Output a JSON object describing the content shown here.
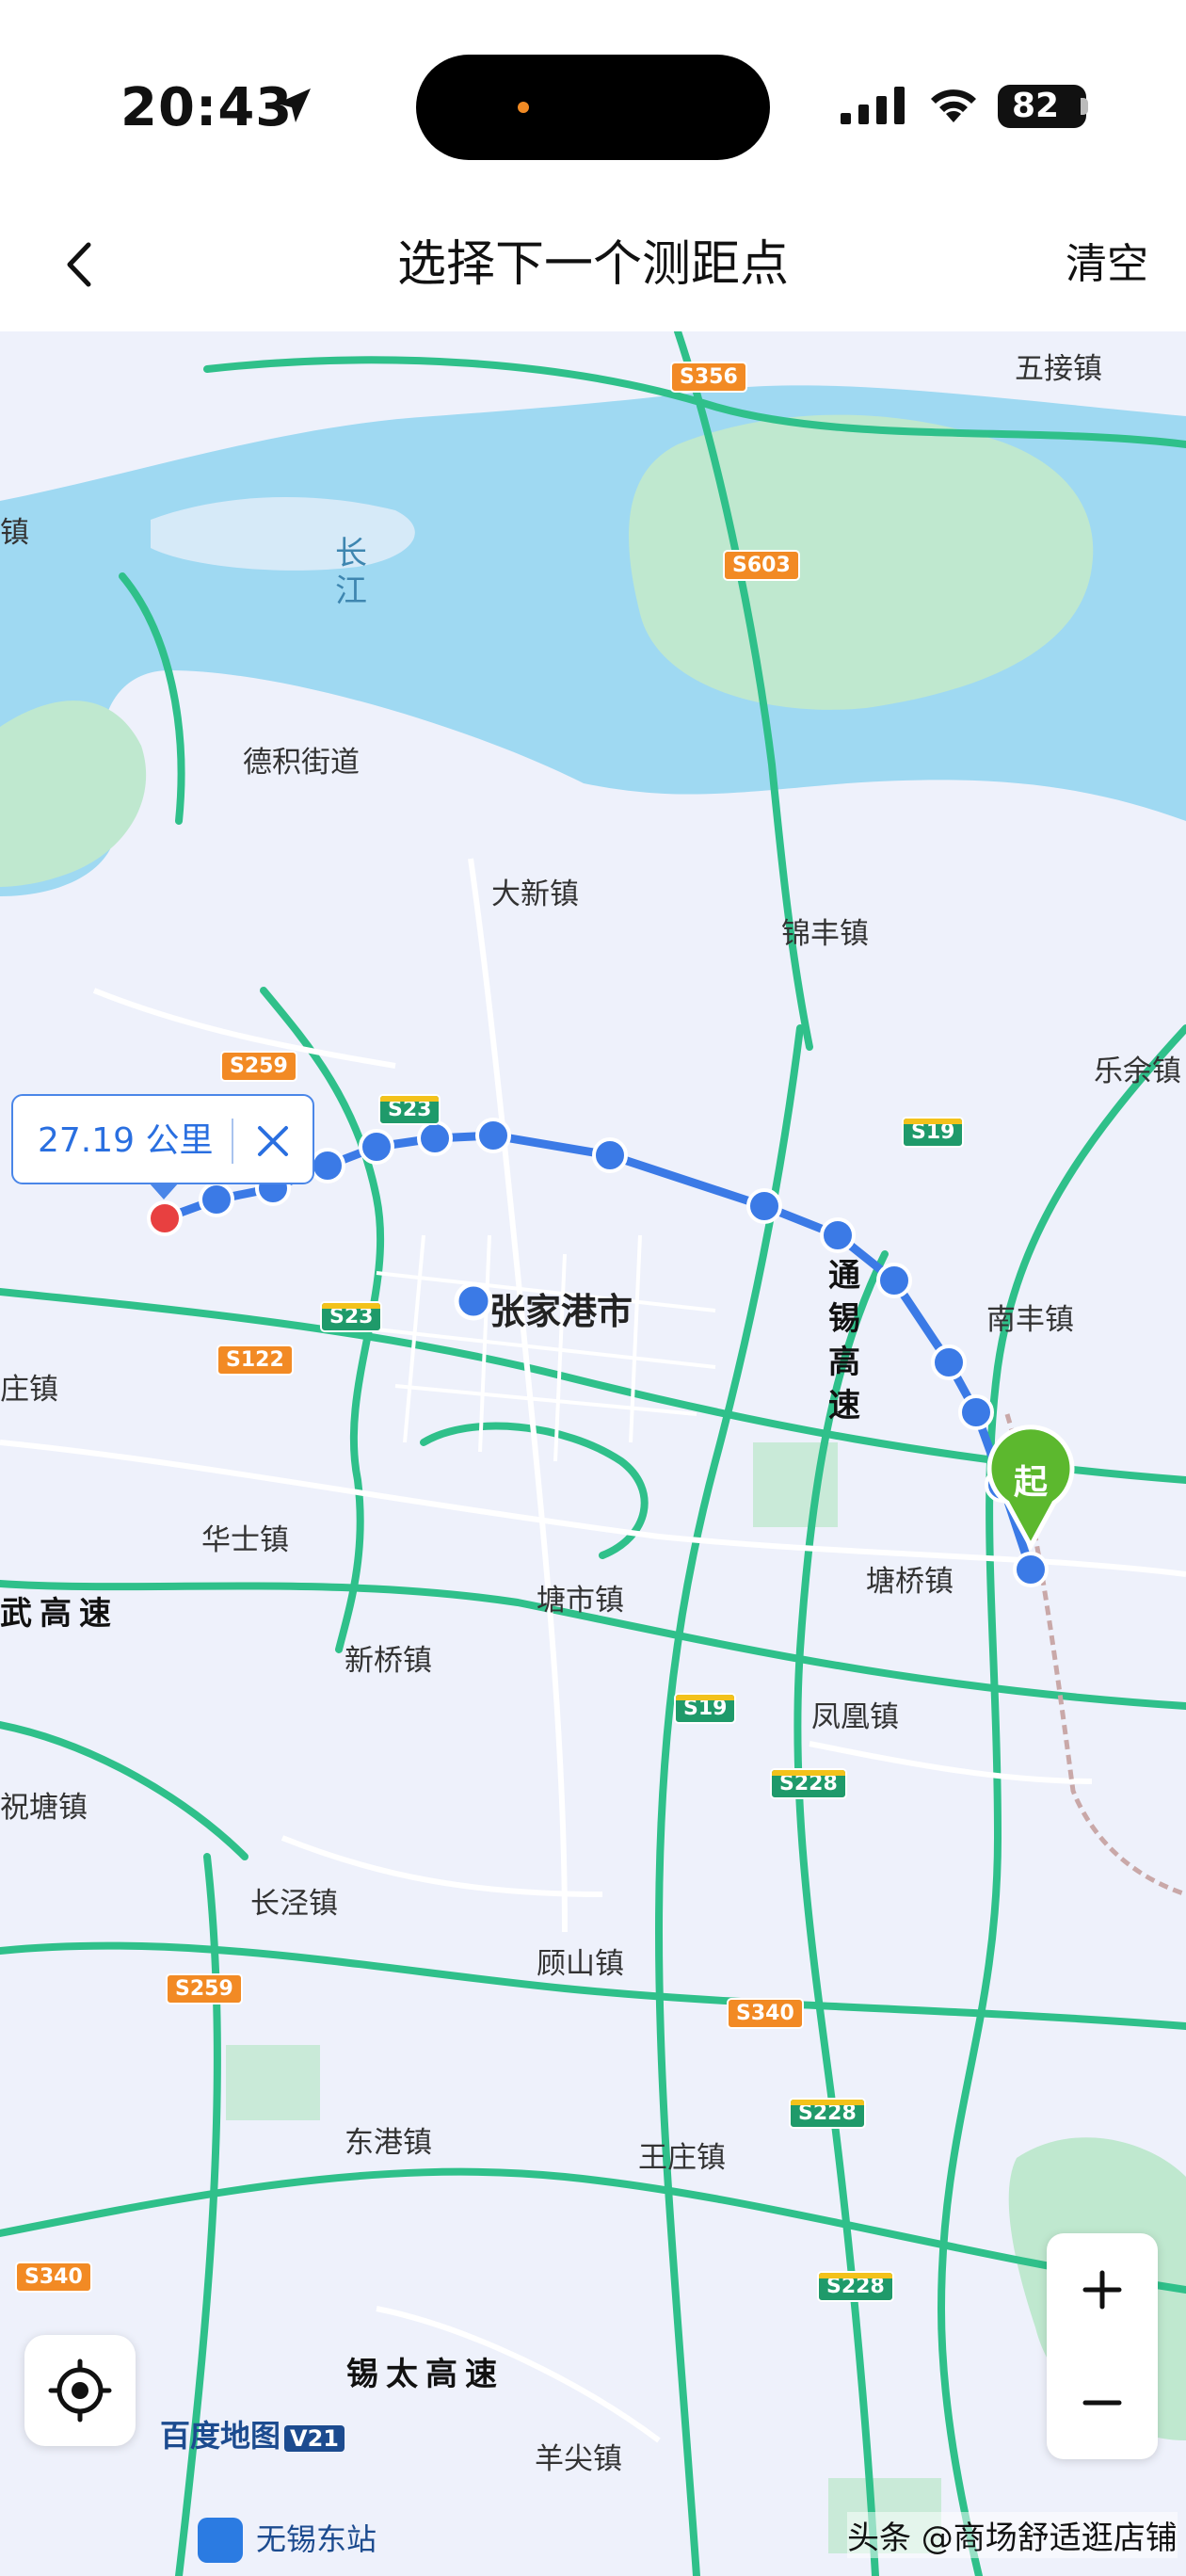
{
  "status": {
    "time": "20:43",
    "battery": "82"
  },
  "nav": {
    "title": "选择下一个测距点",
    "clear_label": "清空"
  },
  "map": {
    "labels": {
      "wujie": "五接镇",
      "zhen_left": "镇",
      "changjiang": "长\n江",
      "deji": "德积街道",
      "daxin": "大新镇",
      "jinfeng": "锦丰镇",
      "leyu": "乐余镇",
      "zhangjiagang": "张家港市",
      "tongxi": "通\n锡\n高\n速",
      "nanfeng": "南丰镇",
      "zhuang": "庄镇",
      "huashi": "华士镇",
      "tangqiao": "塘桥镇",
      "tangshi": "塘市镇",
      "xinqiao": "新桥镇",
      "fenghuang": "凤凰镇",
      "wugao": "武高速",
      "zhutang": "祝塘镇",
      "changjing": "长泾镇",
      "gushan": "顾山镇",
      "donggang": "东港镇",
      "wangzhuang": "王庄镇",
      "xitai": "锡太高速",
      "yangjian": "羊尖镇",
      "station": "无锡东站"
    },
    "shields": {
      "s356": "S356",
      "s603": "S603",
      "s259a": "S259",
      "s23a": "S23",
      "s19a": "S19",
      "s23b": "S23",
      "s122": "S122",
      "s19b": "S19",
      "s228a": "S228",
      "s340a": "S340",
      "s259b": "S259",
      "s228b": "S228",
      "s340b": "S340",
      "s228c": "S228"
    },
    "distance_tip": "27.19 公里",
    "start_marker": "起",
    "brand": "百度地图",
    "brand_version": "V21",
    "watermark": "头条 @商场舒适逛店铺",
    "accent_color": "#3b7ae6",
    "road_color": "#2fc08a",
    "water_color": "#9fd9f2",
    "park_color": "#bfe8cf"
  }
}
